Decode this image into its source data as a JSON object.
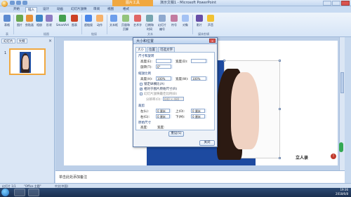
{
  "window": {
    "contextual_tab": "图片工具",
    "title": "演示文稿1 - Microsoft PowerPoint"
  },
  "ribbon_tabs": [
    "开始",
    "插入",
    "设计",
    "动画",
    "幻灯片放映",
    "审阅",
    "视图",
    "格式"
  ],
  "ribbon": {
    "buttons": [
      "表格",
      "图片",
      "剪贴画",
      "相册",
      "形状",
      "SmartArt",
      "图表",
      "超链接",
      "动作",
      "文本框",
      "页眉和页脚",
      "艺术字",
      "日期和时间",
      "幻灯片编号",
      "符号",
      "对象",
      "影片",
      "声音"
    ],
    "groups": [
      "表",
      "插图",
      "链接",
      "文本",
      "媒体剪辑"
    ]
  },
  "left_panel": {
    "tabs": [
      "幻灯片",
      "大纲"
    ],
    "close_glyph": "×",
    "slide_number": "1"
  },
  "dialog": {
    "title": "大小和位置",
    "close_glyph": "×",
    "tabs": [
      "大小",
      "位置",
      "可选文字"
    ],
    "size_rotate_section": "尺寸和旋转",
    "height_label": "高度(E):",
    "width_label": "宽度(D):",
    "rotation_label": "旋转(T):",
    "rotation_value": "0°",
    "scale_section": "缩放比例",
    "scale_height_label": "高度(H):",
    "scale_height_value": "100%",
    "scale_width_label": "宽度(W):",
    "scale_width_value": "100%",
    "lock_aspect": "锁定纵横比(A)",
    "relative_original": "相对于图片原始尺寸(R)",
    "best_scale": "幻灯片放映最佳比例(B)",
    "resolution_label": "分辨率(O):",
    "resolution_value": "640 × 480",
    "crop_section": "裁剪",
    "crop_left_label": "左(L):",
    "crop_left_value": "0 厘米",
    "crop_top_label": "上(O):",
    "crop_top_value": "0 厘米",
    "crop_right_label": "右(G):",
    "crop_right_value": "0 厘米",
    "crop_bottom_label": "下(M):",
    "crop_bottom_value": "0 厘米",
    "original_size_section": "原始尺寸",
    "original_height_label": "高度:",
    "original_width_label": "宽度:",
    "reset_button": "重设(S)",
    "close_button": "关闭"
  },
  "slide": {
    "watermark_text": "立人录",
    "watermark_icon_glyph": "!"
  },
  "notes_placeholder": "单击此处添加备注",
  "status_bar": {
    "slide_info": "幻灯片 1/1",
    "theme": "\"Office 主题\"",
    "language": "中文(中国)"
  },
  "taskbar": {
    "time": "19:36",
    "date": "2018/6/8"
  },
  "colors": {
    "contextual_tab": "#f0a840",
    "photo_background": "#1d4aa0",
    "close_button": "#d9534f"
  }
}
